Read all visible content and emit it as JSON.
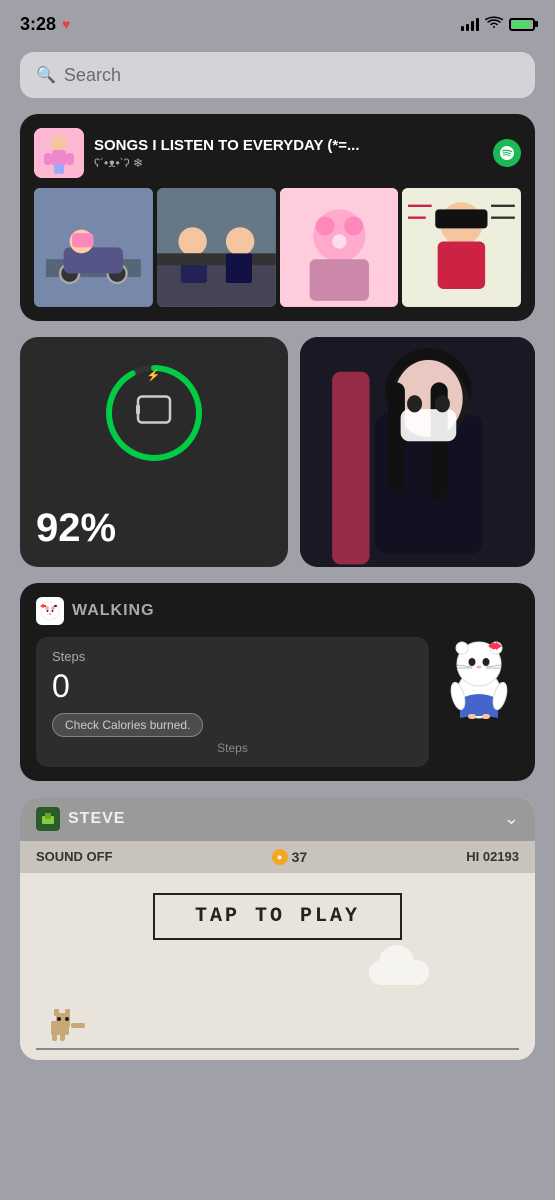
{
  "statusBar": {
    "time": "3:28",
    "heartIcon": "♥",
    "batteryPercent": 90
  },
  "searchBar": {
    "placeholder": "Search"
  },
  "spotifyWidget": {
    "title": "SONGS I LISTEN TO EVERYDAY (*=...",
    "subtitle": "ʕ´•ᴥ•`ʔ ❄",
    "logoLabel": "S"
  },
  "batteryWidget": {
    "percent": "92%",
    "chargeLevel": 92
  },
  "walkingWidget": {
    "title": "WALKING",
    "stepsLabel": "Steps",
    "stepsCount": "0",
    "caloriesBadge": "Check Calories burned.",
    "stepsSubLabel": "Steps"
  },
  "steveWidget": {
    "headerTitle": "STEVE",
    "soundLabel": "SOUND OFF",
    "coinsValue": "37",
    "hiScore": "HI 02193",
    "tapToPlay": "TAP TO PLAY",
    "chevron": "⌄"
  }
}
